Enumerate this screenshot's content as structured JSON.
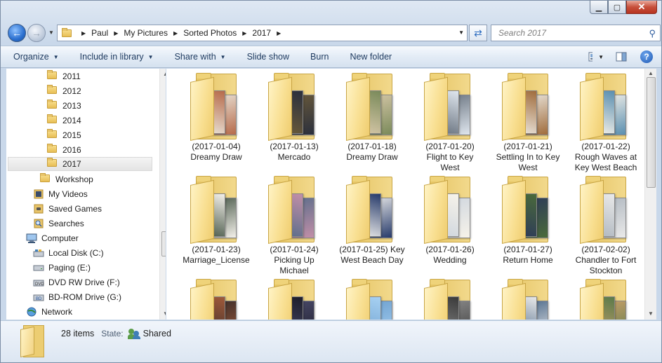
{
  "window": {
    "minimize_glyph": "▁",
    "maximize_glyph": "▢",
    "close_glyph": "✕"
  },
  "nav": {
    "breadcrumb": [
      "Paul",
      "My Pictures",
      "Sorted Photos",
      "2017"
    ],
    "search_placeholder": "Search 2017"
  },
  "toolbar": {
    "organize": "Organize",
    "include_in_library": "Include in library",
    "share_with": "Share with",
    "slide_show": "Slide show",
    "burn": "Burn",
    "new_folder": "New folder"
  },
  "sidebar": {
    "items": [
      {
        "label": "2011",
        "icon": "folder-icon"
      },
      {
        "label": "2012",
        "icon": "folder-icon"
      },
      {
        "label": "2013",
        "icon": "folder-icon"
      },
      {
        "label": "2014",
        "icon": "folder-icon"
      },
      {
        "label": "2015",
        "icon": "folder-icon"
      },
      {
        "label": "2016",
        "icon": "folder-icon"
      },
      {
        "label": "2017",
        "icon": "folder-icon",
        "selected": true
      },
      {
        "label": "Workshop",
        "icon": "folder-icon"
      },
      {
        "label": "My Videos",
        "icon": "videos-library-icon"
      },
      {
        "label": "Saved Games",
        "icon": "saved-games-icon"
      },
      {
        "label": "Searches",
        "icon": "searches-icon"
      },
      {
        "label": "Computer",
        "icon": "computer-icon"
      },
      {
        "label": "Local Disk (C:)",
        "icon": "hard-disk-icon"
      },
      {
        "label": "Paging (E:)",
        "icon": "drive-icon"
      },
      {
        "label": "DVD RW Drive (F:)",
        "icon": "dvd-drive-icon"
      },
      {
        "label": "BD-ROM Drive (G:)",
        "icon": "bd-drive-icon"
      },
      {
        "label": "Network",
        "icon": "network-icon"
      }
    ]
  },
  "folders": [
    {
      "line1": "(2017-01-04)",
      "line2": "Dreamy Draw",
      "line3": ""
    },
    {
      "line1": "(2017-01-13)",
      "line2": "Mercado",
      "line3": ""
    },
    {
      "line1": "(2017-01-18)",
      "line2": "Dreamy Draw",
      "line3": ""
    },
    {
      "line1": "(2017-01-20)",
      "line2": "Flight to Key",
      "line3": "West"
    },
    {
      "line1": "(2017-01-21)",
      "line2": "Settling In to Key",
      "line3": "West"
    },
    {
      "line1": "(2017-01-22)",
      "line2": "Rough Waves at",
      "line3": "Key West Beach"
    },
    {
      "line1": "(2017-01-23)",
      "line2": "Marriage_License",
      "line3": ""
    },
    {
      "line1": "(2017-01-24)",
      "line2": "Picking Up",
      "line3": "Michael"
    },
    {
      "line1": "(2017-01-25) Key",
      "line2": "West Beach Day",
      "line3": ""
    },
    {
      "line1": "(2017-01-26)",
      "line2": "Wedding",
      "line3": ""
    },
    {
      "line1": "(2017-01-27)",
      "line2": "Return Home",
      "line3": ""
    },
    {
      "line1": "(2017-02-02)",
      "line2": "Chandler to Fort",
      "line3": "Stockton"
    },
    {
      "line1": "",
      "line2": "",
      "line3": ""
    },
    {
      "line1": "",
      "line2": "",
      "line3": ""
    },
    {
      "line1": "",
      "line2": "",
      "line3": ""
    },
    {
      "line1": "",
      "line2": "",
      "line3": ""
    },
    {
      "line1": "",
      "line2": "",
      "line3": ""
    },
    {
      "line1": "",
      "line2": "",
      "line3": ""
    }
  ],
  "status": {
    "item_count": "28 items",
    "state_label": "State:",
    "state_value": "Shared"
  },
  "colors": {
    "accent": "#2a6fcf",
    "folder": "#f2d98c"
  }
}
